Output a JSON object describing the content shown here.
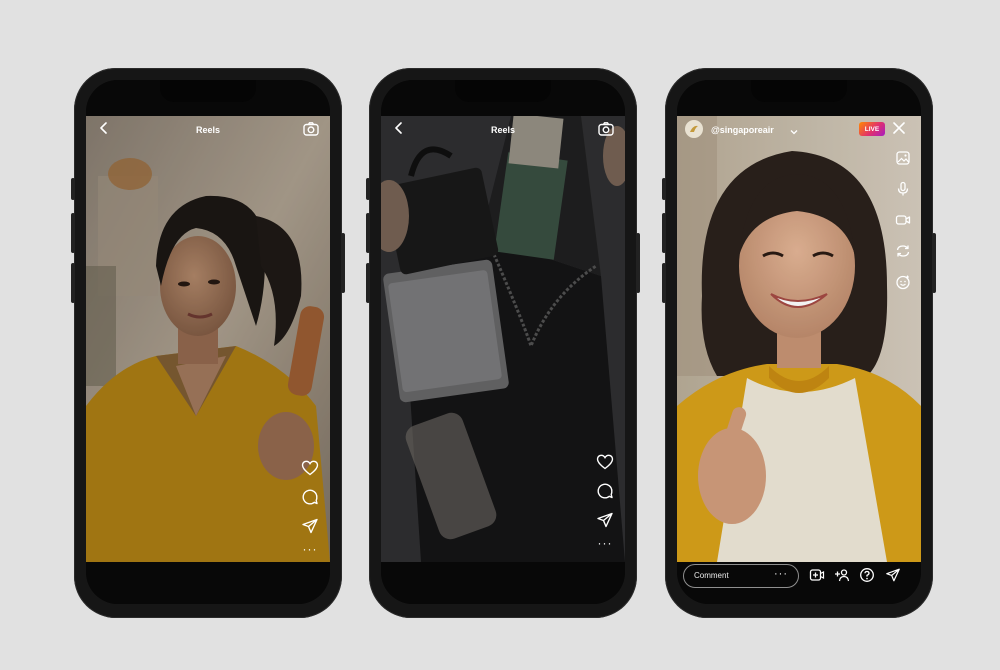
{
  "phones": [
    {
      "header": {
        "back_icon": "back-chevron-icon",
        "title": "Reels",
        "camera_icon": "camera-icon"
      },
      "actions": {
        "like_icon": "heart-icon",
        "comment_icon": "comment-icon",
        "share_icon": "send-icon",
        "more": "···"
      }
    },
    {
      "header": {
        "back_icon": "back-chevron-icon",
        "title": "Reels",
        "camera_icon": "camera-icon"
      },
      "actions": {
        "like_icon": "heart-icon",
        "comment_icon": "comment-icon",
        "share_icon": "send-icon",
        "more": "···"
      }
    },
    {
      "live": {
        "username": "@singaporeair",
        "badge": "LIVE",
        "tools": [
          "gallery-icon",
          "microphone-icon",
          "video-camera-icon",
          "flip-camera-icon",
          "effects-face-icon"
        ],
        "comment_placeholder": "Comment",
        "comment_more": "···",
        "bottom_icons": [
          "add-video-icon",
          "add-guest-icon",
          "question-icon",
          "send-icon"
        ]
      }
    }
  ],
  "colors": {
    "background": "#e1e1e1",
    "phone_body": "#161616",
    "live_badge_start": "#ff8a00",
    "live_badge_end": "#a61dc2",
    "sweater_yellow": "#d8a21a"
  }
}
